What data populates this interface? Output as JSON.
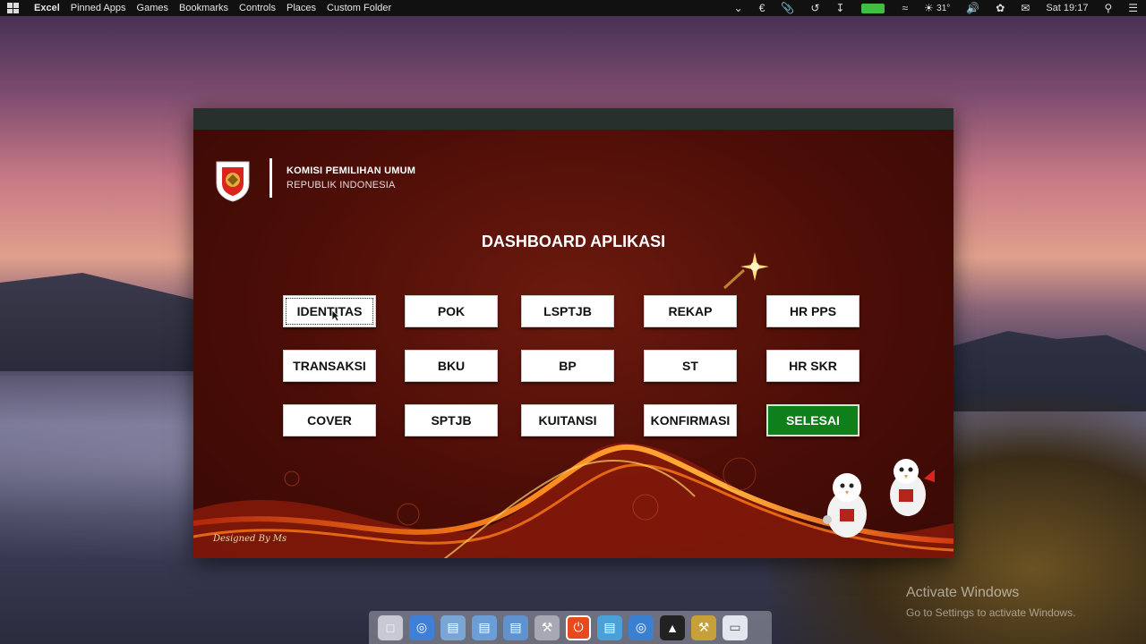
{
  "menubar": {
    "app": "Excel",
    "items": [
      "Pinned Apps",
      "Games",
      "Bookmarks",
      "Controls",
      "Places",
      "Custom Folder"
    ],
    "status": {
      "currency": "€",
      "temperature": "31°",
      "clock": "Sat 19:17"
    }
  },
  "window": {
    "org_line1": "KOMISI PEMILIHAN UMUM",
    "org_line2": "REPUBLIK INDONESIA",
    "title": "DASHBOARD APLIKASI",
    "buttons": {
      "identitas": "IDENTITAS",
      "pok": "POK",
      "lsptjb": "LSPTJB",
      "rekap": "REKAP",
      "hr_pps": "HR PPS",
      "transaksi": "TRANSAKSI",
      "bku": "BKU",
      "bp": "BP",
      "st": "ST",
      "hr_skr": "HR SKR",
      "cover": "COVER",
      "sptjb": "SPTJB",
      "kuitansi": "KUITANSI",
      "konfirmasi": "KONFIRMASI",
      "selesai": "SELESAI"
    },
    "footer_credit": "Designed By Ms"
  },
  "watermark": {
    "line1": "Activate Windows",
    "line2": "Go to Settings to activate Windows."
  },
  "dock_icons": [
    "finder-icon",
    "globe-icon",
    "folder-icon",
    "folder-icon",
    "folder-icon",
    "tools-icon",
    "power-icon",
    "network-icon",
    "globe-icon",
    "shirt-icon",
    "utilities-icon",
    "trash-icon"
  ],
  "colors": {
    "accent_green": "#0f7f1b",
    "panel_red": "#4b0d07"
  }
}
